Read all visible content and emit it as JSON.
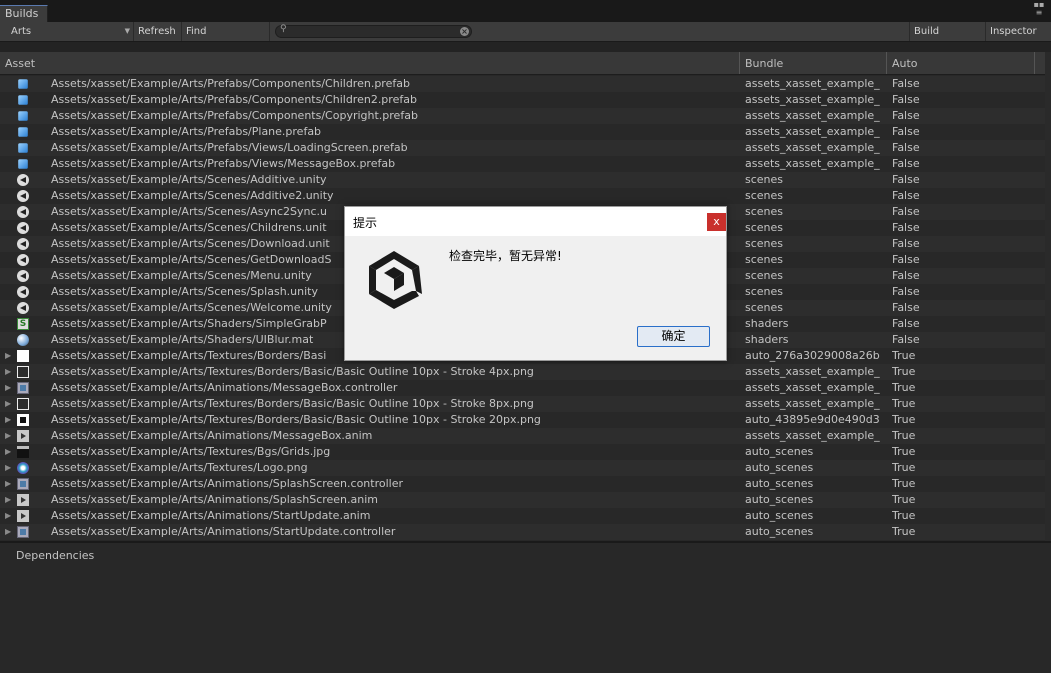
{
  "window": {
    "tab_title": "Builds",
    "menu_icon": "menu-icon"
  },
  "toolbar": {
    "dropdown_value": "Arts",
    "refresh_label": "Refresh",
    "find_references_label": "Find References",
    "search_value": "",
    "build_bundles_label": "Build Bundles",
    "inspector_label": "Inspector"
  },
  "table": {
    "columns": [
      "Asset",
      "Bundle",
      "Auto"
    ],
    "rows": [
      {
        "icon": "prefab-icon",
        "expand": false,
        "asset": "Assets/xasset/Example/Arts/Prefabs/Components/Children.prefab",
        "bundle": "assets_xasset_example_",
        "auto": "False"
      },
      {
        "icon": "prefab-icon",
        "expand": false,
        "asset": "Assets/xasset/Example/Arts/Prefabs/Components/Children2.prefab",
        "bundle": "assets_xasset_example_",
        "auto": "False"
      },
      {
        "icon": "prefab-icon",
        "expand": false,
        "asset": "Assets/xasset/Example/Arts/Prefabs/Components/Copyright.prefab",
        "bundle": "assets_xasset_example_",
        "auto": "False"
      },
      {
        "icon": "prefab-icon",
        "expand": false,
        "asset": "Assets/xasset/Example/Arts/Prefabs/Plane.prefab",
        "bundle": "assets_xasset_example_",
        "auto": "False"
      },
      {
        "icon": "prefab-icon",
        "expand": false,
        "asset": "Assets/xasset/Example/Arts/Prefabs/Views/LoadingScreen.prefab",
        "bundle": "assets_xasset_example_",
        "auto": "False"
      },
      {
        "icon": "prefab-icon",
        "expand": false,
        "asset": "Assets/xasset/Example/Arts/Prefabs/Views/MessageBox.prefab",
        "bundle": "assets_xasset_example_",
        "auto": "False"
      },
      {
        "icon": "scene-icon",
        "expand": false,
        "asset": "Assets/xasset/Example/Arts/Scenes/Additive.unity",
        "bundle": "scenes",
        "auto": "False"
      },
      {
        "icon": "scene-icon",
        "expand": false,
        "asset": "Assets/xasset/Example/Arts/Scenes/Additive2.unity",
        "bundle": "scenes",
        "auto": "False"
      },
      {
        "icon": "scene-icon",
        "expand": false,
        "asset": "Assets/xasset/Example/Arts/Scenes/Async2Sync.u",
        "bundle": "scenes",
        "auto": "False"
      },
      {
        "icon": "scene-icon",
        "expand": false,
        "asset": "Assets/xasset/Example/Arts/Scenes/Childrens.unit",
        "bundle": "scenes",
        "auto": "False"
      },
      {
        "icon": "scene-icon",
        "expand": false,
        "asset": "Assets/xasset/Example/Arts/Scenes/Download.unit",
        "bundle": "scenes",
        "auto": "False"
      },
      {
        "icon": "scene-icon",
        "expand": false,
        "asset": "Assets/xasset/Example/Arts/Scenes/GetDownloadS",
        "bundle": "scenes",
        "auto": "False"
      },
      {
        "icon": "scene-icon",
        "expand": false,
        "asset": "Assets/xasset/Example/Arts/Scenes/Menu.unity",
        "bundle": "scenes",
        "auto": "False"
      },
      {
        "icon": "scene-icon",
        "expand": false,
        "asset": "Assets/xasset/Example/Arts/Scenes/Splash.unity",
        "bundle": "scenes",
        "auto": "False"
      },
      {
        "icon": "scene-icon",
        "expand": false,
        "asset": "Assets/xasset/Example/Arts/Scenes/Welcome.unity",
        "bundle": "scenes",
        "auto": "False"
      },
      {
        "icon": "shader-icon",
        "expand": false,
        "asset": "Assets/xasset/Example/Arts/Shaders/SimpleGrabP",
        "bundle": "shaders",
        "auto": "False"
      },
      {
        "icon": "material-icon",
        "expand": false,
        "asset": "Assets/xasset/Example/Arts/Shaders/UIBlur.mat",
        "bundle": "shaders",
        "auto": "False"
      },
      {
        "icon": "texture-white-icon",
        "expand": true,
        "asset": "Assets/xasset/Example/Arts/Textures/Borders/Basi",
        "bundle": "auto_276a3029008a26b",
        "auto": "True"
      },
      {
        "icon": "texture-outline-icon",
        "expand": true,
        "asset": "Assets/xasset/Example/Arts/Textures/Borders/Basic/Basic Outline 10px - Stroke 4px.png",
        "bundle": "assets_xasset_example_",
        "auto": "True"
      },
      {
        "icon": "animator-controller-icon",
        "expand": true,
        "asset": "Assets/xasset/Example/Arts/Animations/MessageBox.controller",
        "bundle": "assets_xasset_example_",
        "auto": "True"
      },
      {
        "icon": "texture-outline-icon",
        "expand": true,
        "asset": "Assets/xasset/Example/Arts/Textures/Borders/Basic/Basic Outline 10px - Stroke 8px.png",
        "bundle": "assets_xasset_example_",
        "auto": "True"
      },
      {
        "icon": "texture-thick-outline-icon",
        "expand": true,
        "asset": "Assets/xasset/Example/Arts/Textures/Borders/Basic/Basic Outline 10px - Stroke 20px.png",
        "bundle": "auto_43895e9d0e490d3",
        "auto": "True"
      },
      {
        "icon": "animation-clip-icon",
        "expand": true,
        "asset": "Assets/xasset/Example/Arts/Animations/MessageBox.anim",
        "bundle": "assets_xasset_example_",
        "auto": "True"
      },
      {
        "icon": "texture-grid-icon",
        "expand": true,
        "asset": "Assets/xasset/Example/Arts/Textures/Bgs/Grids.jpg",
        "bundle": "auto_scenes",
        "auto": "True"
      },
      {
        "icon": "texture-logo-icon",
        "expand": true,
        "asset": "Assets/xasset/Example/Arts/Textures/Logo.png",
        "bundle": "auto_scenes",
        "auto": "True"
      },
      {
        "icon": "animator-controller-icon",
        "expand": true,
        "asset": "Assets/xasset/Example/Arts/Animations/SplashScreen.controller",
        "bundle": "auto_scenes",
        "auto": "True"
      },
      {
        "icon": "animation-clip-icon",
        "expand": true,
        "asset": "Assets/xasset/Example/Arts/Animations/SplashScreen.anim",
        "bundle": "auto_scenes",
        "auto": "True"
      },
      {
        "icon": "animation-clip-icon",
        "expand": true,
        "asset": "Assets/xasset/Example/Arts/Animations/StartUpdate.anim",
        "bundle": "auto_scenes",
        "auto": "True"
      },
      {
        "icon": "animator-controller-icon",
        "expand": true,
        "asset": "Assets/xasset/Example/Arts/Animations/StartUpdate.controller",
        "bundle": "auto_scenes",
        "auto": "True"
      }
    ]
  },
  "dependencies": {
    "label": "Dependencies"
  },
  "dialog": {
    "title": "提示",
    "close_label": "x",
    "message": "检查完毕，暂无异常!",
    "ok_label": "确定"
  },
  "colors": {
    "background": "#282828",
    "row_alt": "#2d2d2d",
    "dialog_close": "#c9302c",
    "button_border": "#2a6fc9"
  }
}
